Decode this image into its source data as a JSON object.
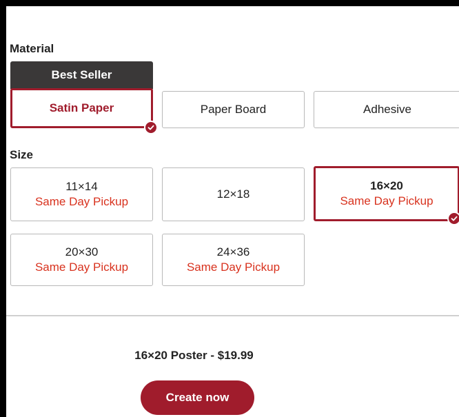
{
  "material": {
    "label": "Material",
    "badge": "Best Seller",
    "options": [
      {
        "label": "Satin Paper",
        "selected": true
      },
      {
        "label": "Paper Board",
        "selected": false
      },
      {
        "label": "Adhesive",
        "selected": false
      }
    ]
  },
  "size": {
    "label": "Size",
    "options": [
      {
        "label": "11×14",
        "note": "Same Day Pickup",
        "selected": false
      },
      {
        "label": "12×18",
        "note": "",
        "selected": false
      },
      {
        "label": "16×20",
        "note": "Same Day Pickup",
        "selected": true
      },
      {
        "label": "20×30",
        "note": "Same Day Pickup",
        "selected": false
      },
      {
        "label": "24×36",
        "note": "Same Day Pickup",
        "selected": false
      }
    ]
  },
  "summary": "16×20 Poster - $19.99",
  "create_button": "Create now",
  "colors": {
    "accent": "#a01c2c",
    "pickup_text": "#d8321e",
    "badge_bg": "#3a3838"
  }
}
